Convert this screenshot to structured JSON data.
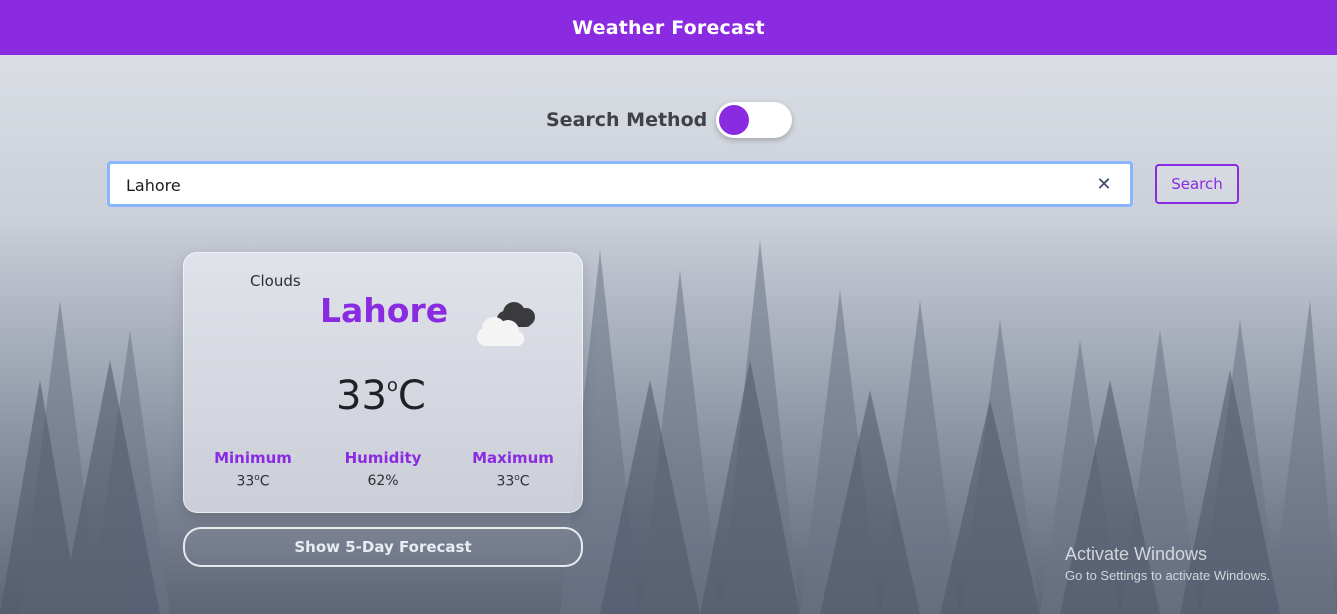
{
  "header": {
    "title": "Weather Forecast"
  },
  "search_method": {
    "label": "Search Method",
    "toggle_on": true
  },
  "search": {
    "value": "Lahore",
    "clear_icon": "close-icon",
    "button_label": "Search"
  },
  "weather_card": {
    "condition": "Clouds",
    "city": "Lahore",
    "icon": "cloud-icon",
    "temperature": "33",
    "unit": "C",
    "stats": [
      {
        "label": "Minimum",
        "value": "33",
        "unit": "C"
      },
      {
        "label": "Humidity",
        "value": "62%",
        "unit": ""
      },
      {
        "label": "Maximum",
        "value": "33",
        "unit": "C"
      }
    ]
  },
  "forecast_button": {
    "label": "Show 5-Day Forecast"
  },
  "watermark": {
    "title": "Activate Windows",
    "subtitle": "Go to Settings to activate Windows."
  },
  "colors": {
    "accent": "#8a2be2",
    "focus_border": "#86b7fe"
  }
}
